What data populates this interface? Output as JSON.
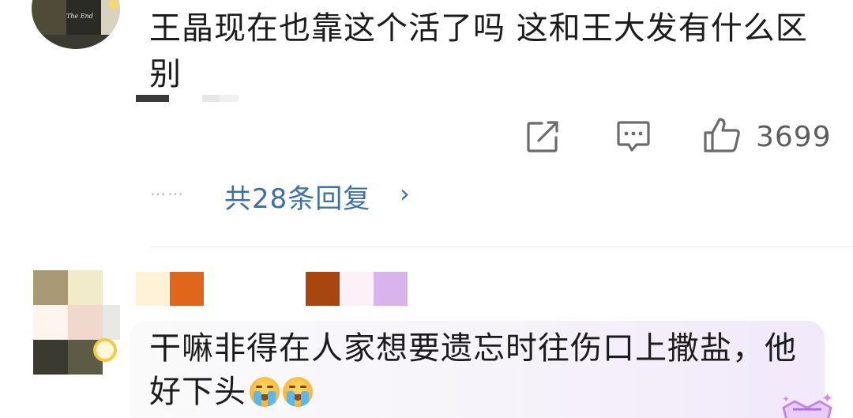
{
  "comment1": {
    "avatar_caption": "The End",
    "text": "王晶现在也靠这个活了吗 这和王大发有什么区别",
    "avatar_colors": [
      "#4e4b39",
      "#2b2b26",
      "#d7d3c0"
    ],
    "name_colors": [
      "#3a3a3a",
      "#ffffff",
      "#e7e7e7",
      "#f0f0f0"
    ],
    "actions": {
      "share_icon": "share-edit-icon",
      "comment_icon": "comment-icon",
      "like_icon": "thumbs-up-icon",
      "like_count": "3699"
    },
    "replies": {
      "dots": "……",
      "label": "共28条回复",
      "chevron": "›"
    }
  },
  "comment2": {
    "text": "干嘛非得在人家想要遗忘时往伤口上撒盐，他好下头",
    "emoji_name": "tears-emoji",
    "avatar_colors": [
      "#a99a75",
      "#f1ebca",
      "#ffffff",
      "#fdf5ee",
      "#f1d8cc",
      "#e8e8e6",
      "#3a3a30",
      "#5c5b45",
      "#ffffff"
    ],
    "name_colors": [
      "#fff2d8",
      "#e0661b",
      "#ffffff",
      "#ffffff",
      "#ffffff",
      "#a8460f",
      "#fdf1f7",
      "#d9b3eb"
    ],
    "badge_icon": "vip-crown-badge-icon"
  },
  "colors": {
    "link_blue": "#3d6fa8",
    "icon_gray": "#6b6b6b",
    "count_gray": "#5d5d5d",
    "divider": "#ececec"
  }
}
